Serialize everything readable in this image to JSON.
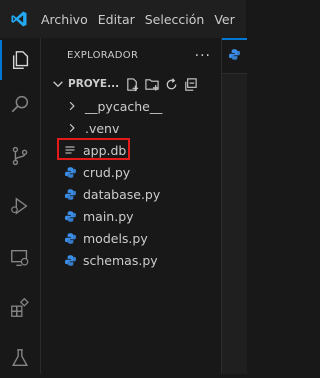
{
  "titlebar": {
    "logo_icon": "vscode-logo-icon",
    "menu": [
      "Archivo",
      "Editar",
      "Selección",
      "Ver"
    ]
  },
  "activity_bar": {
    "items": [
      {
        "name": "explorer-icon",
        "active": true
      },
      {
        "name": "search-icon",
        "active": false
      },
      {
        "name": "source-control-icon",
        "active": false
      },
      {
        "name": "run-debug-icon",
        "active": false
      },
      {
        "name": "remote-explorer-icon",
        "active": false
      },
      {
        "name": "extensions-icon",
        "active": false
      },
      {
        "name": "testing-icon",
        "active": false
      }
    ]
  },
  "sidebar": {
    "title": "EXPLORADOR",
    "more_label": "···",
    "folder": {
      "name": "PROYE...",
      "actions": [
        "new-file-icon",
        "new-folder-icon",
        "refresh-icon",
        "collapse-all-icon"
      ]
    },
    "entries": [
      {
        "label": "__pycache__",
        "kind": "folder",
        "icon": "chevron-right-icon"
      },
      {
        "label": ".venv",
        "kind": "folder",
        "icon": "chevron-right-icon"
      },
      {
        "label": "app.db",
        "kind": "file",
        "icon": "text-file-icon",
        "highlighted": true
      },
      {
        "label": "crud.py",
        "kind": "file",
        "icon": "python-file-icon"
      },
      {
        "label": "database.py",
        "kind": "file",
        "icon": "python-file-icon"
      },
      {
        "label": "main.py",
        "kind": "file",
        "icon": "python-file-icon"
      },
      {
        "label": "models.py",
        "kind": "file",
        "icon": "python-file-icon"
      },
      {
        "label": "schemas.py",
        "kind": "file",
        "icon": "python-file-icon"
      }
    ]
  },
  "colors": {
    "accent": "#0078d4",
    "python_icon": "#3b8eea",
    "highlight_box": "#e51a1a"
  }
}
